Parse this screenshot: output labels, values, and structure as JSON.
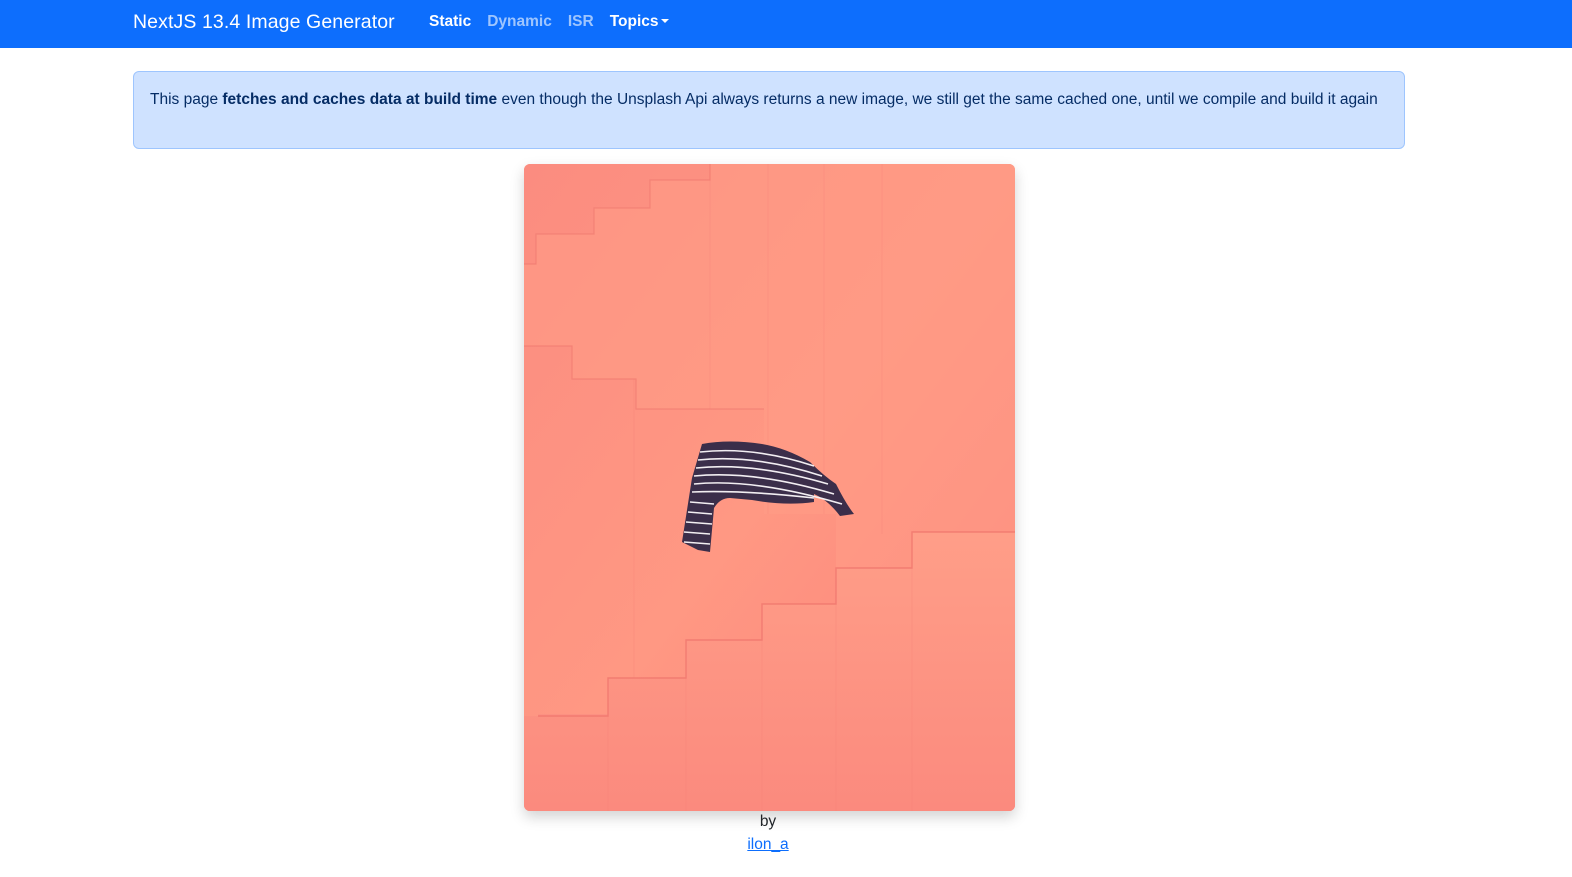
{
  "navbar": {
    "brand": "NextJS 13.4 Image Generator",
    "links": [
      {
        "label": "Static",
        "active": true
      },
      {
        "label": "Dynamic",
        "active": false
      },
      {
        "label": "ISR",
        "active": false
      },
      {
        "label": "Topics",
        "active": false,
        "dropdown": true
      }
    ],
    "color": "#0d6efd"
  },
  "alert": {
    "prefix": "This page ",
    "emphasis": "fetches and caches data at build time",
    "suffix": " even though the Unsplash Api always returns a new image, we still get the same cached one, until we compile and build it again"
  },
  "image": {
    "alt": "Striped shirt lying on coral pink stairs",
    "caption_by": "by",
    "author": "ilon_a"
  }
}
